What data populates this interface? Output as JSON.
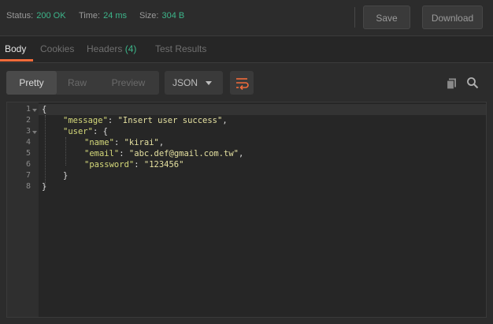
{
  "status": {
    "status_label": "Status:",
    "status_value": "200 OK",
    "time_label": "Time:",
    "time_value": "24 ms",
    "size_label": "Size:",
    "size_value": "304 B"
  },
  "actions": {
    "save": "Save",
    "download": "Download"
  },
  "tabs": {
    "body": "Body",
    "cookies": "Cookies",
    "headers": "Headers",
    "headers_count": "(4)",
    "test_results": "Test Results"
  },
  "view": {
    "pretty": "Pretty",
    "raw": "Raw",
    "preview": "Preview",
    "format": "JSON"
  },
  "code": {
    "line_numbers": [
      "1",
      "2",
      "3",
      "4",
      "5",
      "6",
      "7",
      "8"
    ],
    "lines": {
      "l1": {
        "open": "{"
      },
      "l2": {
        "key": "\"message\"",
        "colon": ": ",
        "value": "\"Insert user success\"",
        "comma": ","
      },
      "l3": {
        "key": "\"user\"",
        "colon": ": ",
        "open": "{"
      },
      "l4": {
        "key": "\"name\"",
        "colon": ": ",
        "value": "\"kirai\"",
        "comma": ","
      },
      "l5": {
        "key": "\"email\"",
        "colon": ": ",
        "value": "\"abc.def@gmail.com.tw\"",
        "comma": ","
      },
      "l6": {
        "key": "\"password\"",
        "colon": ": ",
        "value": "\"123456\""
      },
      "l7": {
        "close": "}"
      },
      "l8": {
        "close": "}"
      }
    }
  },
  "colors": {
    "accent_orange": "#f26b3a",
    "status_green": "#3db58a",
    "json_key": "#d5d97a",
    "json_string": "#e4e0a0"
  },
  "icons": [
    "wrap-lines-icon",
    "copy-icon",
    "search-icon",
    "chevron-down-icon",
    "fold-arrow-icon"
  ]
}
